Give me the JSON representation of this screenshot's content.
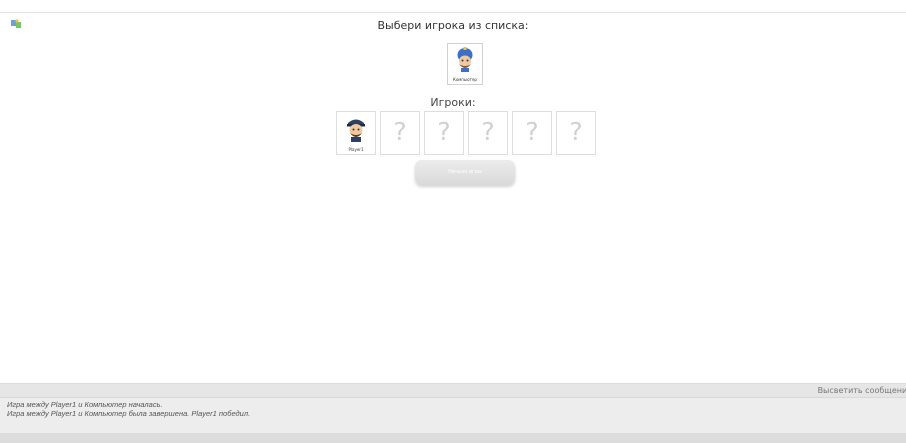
{
  "selection": {
    "title": "Выбери игрока из списка:",
    "candidates": [
      {
        "name": "Компьютер"
      }
    ]
  },
  "players": {
    "title": "Игроки:",
    "slots": [
      {
        "name": "Player1",
        "filled": true
      },
      {
        "placeholder": "?"
      },
      {
        "placeholder": "?"
      },
      {
        "placeholder": "?"
      },
      {
        "placeholder": "?"
      },
      {
        "placeholder": "?"
      }
    ]
  },
  "start_button": {
    "label": "Начало игры"
  },
  "log": {
    "highlight_label": "Высветить сообщения",
    "lines": [
      "Игра между Player1 и Компьютер началась.",
      "Игра между Player1 и Компьютер была завершена. Player1 победил."
    ]
  }
}
